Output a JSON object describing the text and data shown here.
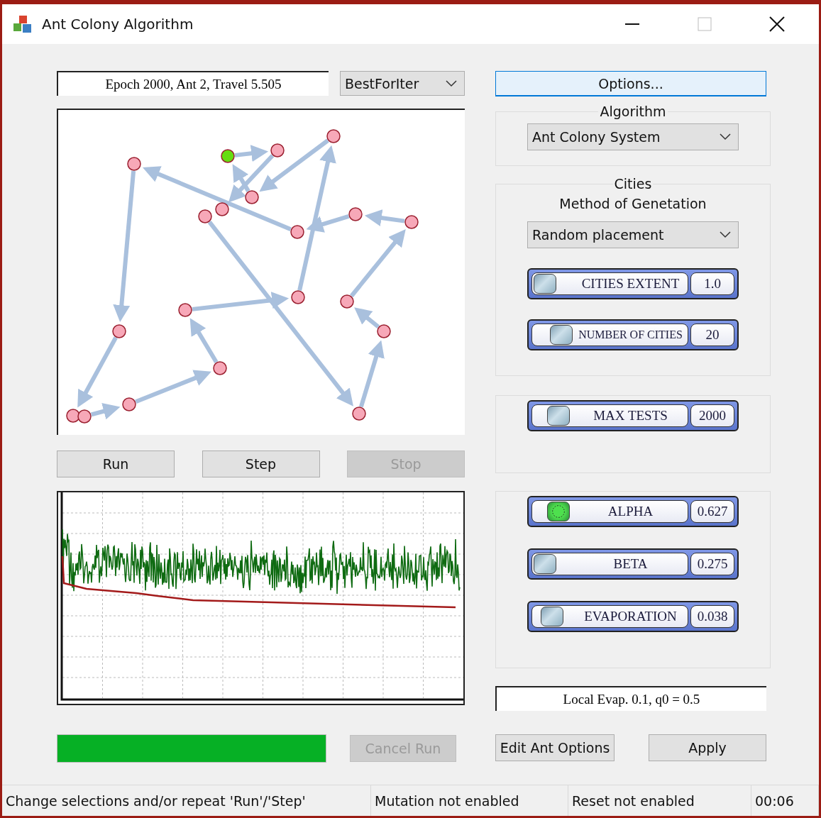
{
  "window": {
    "title": "Ant Colony Algorithm"
  },
  "epoch_text": "Epoch 2000, Ant 2, Travel 5.505",
  "view_select": {
    "value": "BestForIter"
  },
  "run_buttons": [
    {
      "label": "Run",
      "disabled": false
    },
    {
      "label": "Step",
      "disabled": false
    },
    {
      "label": "Stop",
      "disabled": true
    }
  ],
  "progress": {
    "level": 1
  },
  "cancel_button": {
    "label": "Cancel Run",
    "disabled": true
  },
  "options_button": {
    "label": "Options..."
  },
  "algorithm": {
    "title": "Algorithm",
    "value": "Ant Colony System"
  },
  "cities": {
    "title": "Cities",
    "method_label": "Method of Genetation",
    "method_value": "Random placement",
    "sliders": [
      {
        "label": "CITIES EXTENT",
        "value": "1.0",
        "level": 0,
        "focused": false
      },
      {
        "label": "NUMBER OF CITIES",
        "value": "20",
        "level": 0.12,
        "focused": false
      }
    ]
  },
  "tests": {
    "sliders": [
      {
        "label": "MAX TESTS",
        "value": "2000",
        "level": 0.1,
        "focused": false
      }
    ]
  },
  "parameters": {
    "sliders": [
      {
        "label": "ALPHA",
        "value": "0.627",
        "level": 0.1,
        "focused": true
      },
      {
        "label": "BETA",
        "value": "0.275",
        "level": 0,
        "focused": false
      },
      {
        "label": "EVAPORATION",
        "value": "0.038",
        "level": 0.05,
        "focused": false
      }
    ]
  },
  "info_text": "Local Evap. 0.1, q0 = 0.5",
  "action_buttons": [
    {
      "label": "Edit Ant Options",
      "disabled": false
    },
    {
      "label": "Apply",
      "disabled": false
    }
  ],
  "status_bar": [
    "Change selections and/or repeat 'Run'/'Step'",
    "Mutation not enabled",
    "Reset not enabled",
    "00:06"
  ]
}
